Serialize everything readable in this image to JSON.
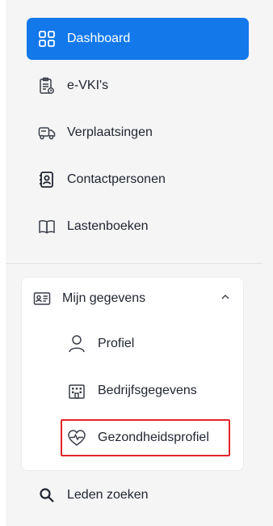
{
  "nav": {
    "dashboard": "Dashboard",
    "evki": "e-VKI's",
    "verplaatsingen": "Verplaatsingen",
    "contactpersonen": "Contactpersonen",
    "lastenboeken": "Lastenboeken"
  },
  "group": {
    "title": "Mijn gegevens",
    "items": {
      "profiel": "Profiel",
      "bedrijfsgegevens": "Bedrijfsgegevens",
      "gezondheidsprofiel": "Gezondheidsprofiel"
    }
  },
  "search": {
    "label": "Leden zoeken"
  },
  "colors": {
    "accent": "#1378ea",
    "highlight_border": "#e0262b"
  }
}
